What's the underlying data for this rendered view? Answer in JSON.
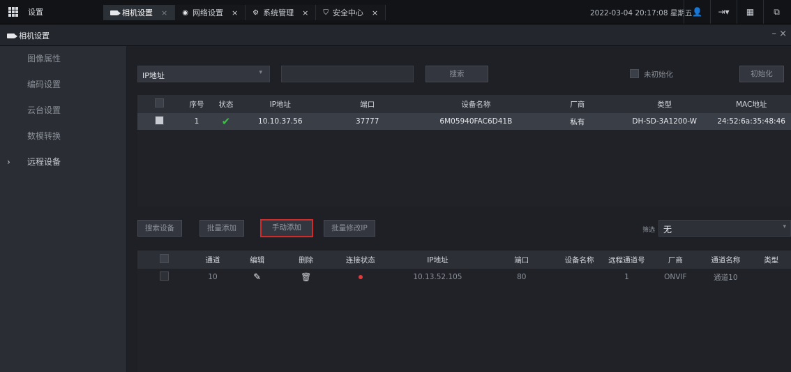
{
  "topbar": {
    "home_label": "设置",
    "tabs": [
      {
        "label": "相机设置",
        "icon": "camera-icon",
        "close": "×"
      },
      {
        "label": "网络设置",
        "icon": "globe-icon",
        "close": "×"
      },
      {
        "label": "系统管理",
        "icon": "gears-icon",
        "close": "×"
      },
      {
        "label": "安全中心",
        "icon": "shield-icon",
        "close": "×"
      }
    ],
    "datetime": "2022-03-04 20:17:08 星期五",
    "icons": [
      "user-icon",
      "logout-icon",
      "layout-icon",
      "screen-icon"
    ]
  },
  "window": {
    "title": "相机设置",
    "close": "– ×"
  },
  "sidebar": {
    "items": [
      {
        "label": "图像属性"
      },
      {
        "label": "编码设置"
      },
      {
        "label": "云台设置"
      },
      {
        "label": "数模转换"
      },
      {
        "label": "远程设备",
        "chevron": "›"
      }
    ]
  },
  "search": {
    "filter_select": "IP地址",
    "input_value": "",
    "search_button": "搜索",
    "uninit_label": "未初始化",
    "init_button": "初始化"
  },
  "device_table": {
    "headers": [
      "序号",
      "状态",
      "IP地址",
      "端口",
      "设备名称",
      "厂商",
      "类型",
      "MAC地址"
    ],
    "rows": [
      {
        "index": "1",
        "ip": "10.10.37.56",
        "port": "37777",
        "name": "6M05940FAC6D41B",
        "vendor": "私有",
        "type": "DH-SD-3A1200-W",
        "mac": "24:52:6a:35:48:46"
      }
    ]
  },
  "actions": {
    "search_devices": "搜索设备",
    "batch_add": "批量添加",
    "manual_add": "手动添加",
    "batch_modify_ip": "批量修改IP",
    "filter_label": "筛选",
    "filter_value": "无"
  },
  "channel_table": {
    "headers": [
      "通道",
      "编辑",
      "删除",
      "连接状态",
      "IP地址",
      "端口",
      "设备名称",
      "远程通道号",
      "厂商",
      "通道名称",
      "类型"
    ],
    "rows": [
      {
        "channel": "10",
        "ip": "10.13.52.105",
        "port": "80",
        "device_name": "",
        "remote_ch": "1",
        "vendor": "ONVIF",
        "ch_name": "通道10",
        "type": ""
      }
    ]
  }
}
